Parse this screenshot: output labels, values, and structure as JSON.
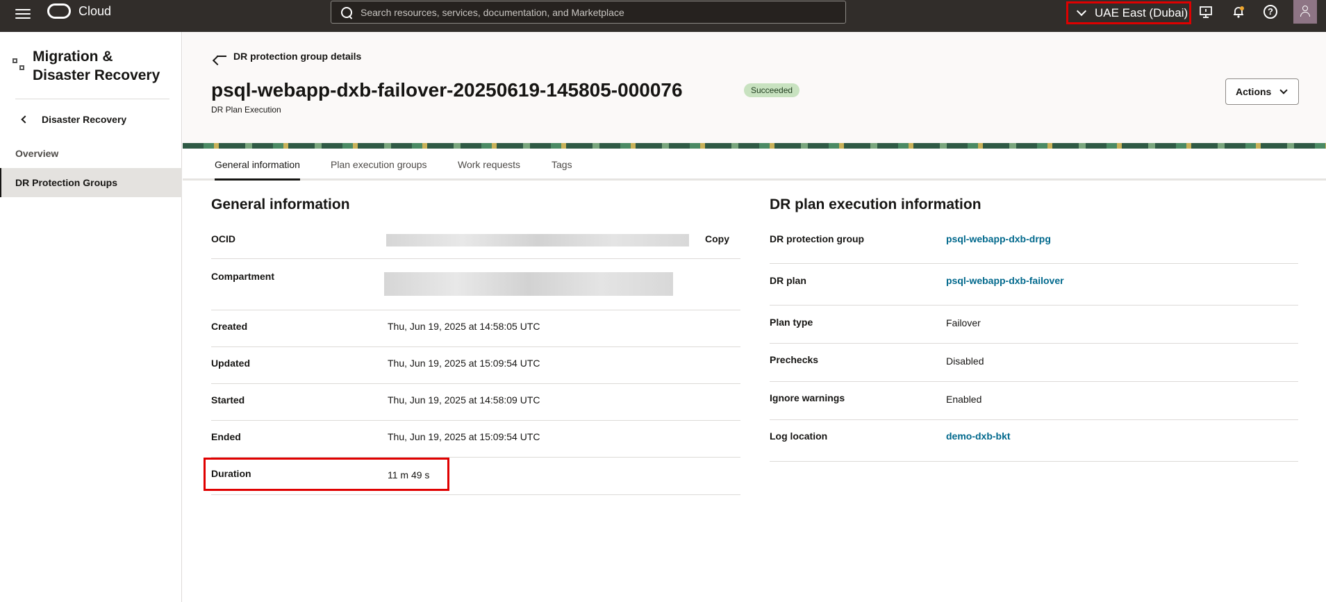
{
  "topbar": {
    "brand": "Cloud",
    "search_placeholder": "Search resources, services, documentation, and Marketplace",
    "region": "UAE East (Dubai)",
    "icons": [
      "menu-icon",
      "announcements-icon",
      "notifications-icon",
      "help-icon",
      "profile-icon"
    ]
  },
  "sidebar": {
    "title": "Migration & Disaster Recovery",
    "back_label": "Disaster Recovery",
    "items": [
      {
        "label": "Overview"
      },
      {
        "label": "DR Protection Groups",
        "active": true
      }
    ]
  },
  "header": {
    "back_link": "DR protection group details",
    "title": "psql-webapp-dxb-failover-20250619-145805-000076",
    "status": "Succeeded",
    "subtitle": "DR Plan Execution",
    "actions_label": "Actions"
  },
  "tabs": [
    {
      "label": "General information",
      "active": true
    },
    {
      "label": "Plan execution groups"
    },
    {
      "label": "Work requests"
    },
    {
      "label": "Tags"
    }
  ],
  "general": {
    "title": "General information",
    "ocid_label": "OCID",
    "copy_label": "Copy",
    "compartment_label": "Compartment",
    "created_label": "Created",
    "created": "Thu, Jun 19, 2025 at 14:58:05 UTC",
    "updated_label": "Updated",
    "updated": "Thu, Jun 19, 2025 at 15:09:54 UTC",
    "started_label": "Started",
    "started": "Thu, Jun 19, 2025 at 14:58:09 UTC",
    "ended_label": "Ended",
    "ended": "Thu, Jun 19, 2025 at 15:09:54 UTC",
    "duration_label": "Duration",
    "duration": "11 m 49 s"
  },
  "execution": {
    "title": "DR plan execution information",
    "protection_group_label": "DR protection group",
    "protection_group": "psql-webapp-dxb-drpg",
    "plan_label": "DR plan",
    "plan": "psql-webapp-dxb-failover",
    "plan_type_label": "Plan type",
    "plan_type": "Failover",
    "prechecks_label": "Prechecks",
    "prechecks": "Disabled",
    "ignore_warnings_label": "Ignore warnings",
    "ignore_warnings": "Enabled",
    "log_location_label": "Log location",
    "log_location": "demo-dxb-bkt"
  },
  "colors": {
    "topbar": "#312d2a",
    "link": "#00688c",
    "highlight": "#e00000",
    "success_badge": "#c8e2c0"
  }
}
